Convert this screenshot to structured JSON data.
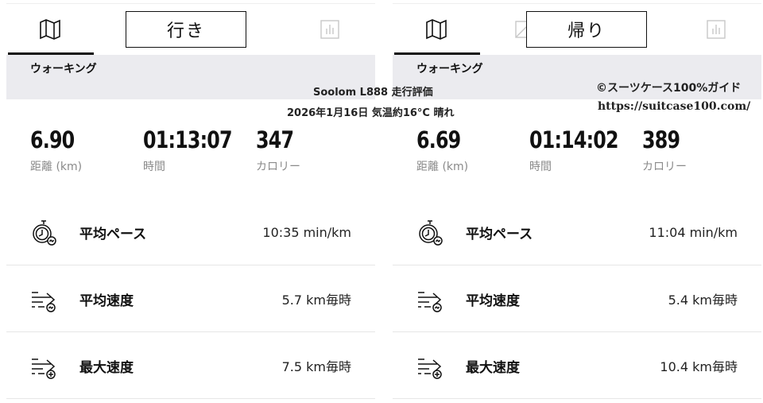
{
  "left": {
    "label": "行き",
    "activity": "ウォーキング",
    "stats": [
      {
        "value": "6.90",
        "label": "距離 (km)"
      },
      {
        "value": "01:13:07",
        "label": "時間"
      },
      {
        "value": "347",
        "label": "カロリー"
      }
    ],
    "metrics": [
      {
        "name": "平均ペース",
        "value": "10:35 min/km"
      },
      {
        "name": "平均速度",
        "value": "5.7 km毎時"
      },
      {
        "name": "最大速度",
        "value": "7.5 km毎時"
      }
    ]
  },
  "right": {
    "label": "帰り",
    "activity": "ウォーキング",
    "stats": [
      {
        "value": "6.69",
        "label": "距離 (km)"
      },
      {
        "value": "01:14:02",
        "label": "時間"
      },
      {
        "value": "389",
        "label": "カロリー"
      }
    ],
    "metrics": [
      {
        "name": "平均ペース",
        "value": "11:04 min/km"
      },
      {
        "name": "平均速度",
        "value": "5.4 km毎時"
      },
      {
        "name": "最大速度",
        "value": "10.4 km毎時"
      }
    ]
  },
  "watermark": {
    "title": "Soolom L888 走行評価",
    "date_weather": "2026年1月16日 気温約16°C 晴れ",
    "credit": "©スーツケース100%ガイド",
    "url": "https://suitcase100.com/"
  },
  "icons": {
    "map": "map-icon",
    "chart": "bar-chart-icon",
    "pace": "stopwatch-icon",
    "speed": "speed-lines-icon",
    "max_speed": "speed-lines-plus-icon"
  }
}
